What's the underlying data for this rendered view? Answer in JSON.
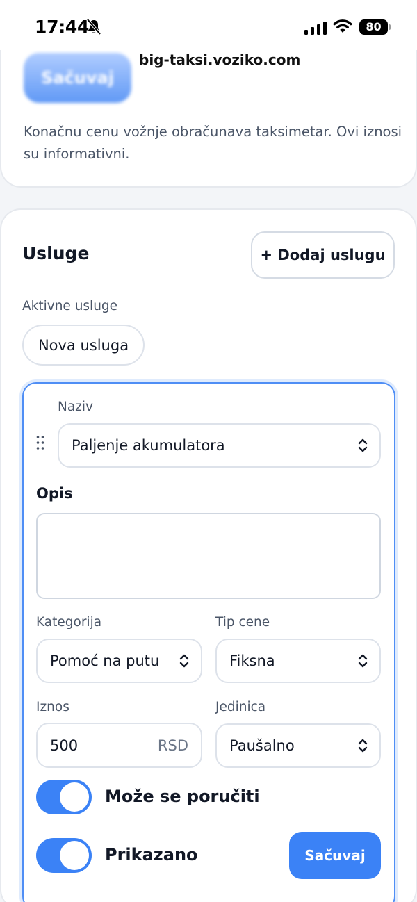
{
  "status_bar": {
    "time": "17:44",
    "battery": "80",
    "icons": [
      "bell-slash-icon",
      "cellular-signal-icon",
      "wifi-icon",
      "battery-icon"
    ]
  },
  "top_card": {
    "ghost_save_label": "Sačuvaj",
    "domain": "big-taksi.voziko.com",
    "info": "Konačnu cenu vožnje obračunava taksimetar. Ovi iznosi su informativni."
  },
  "services": {
    "title": "Usluge",
    "add_button": "+ Dodaj uslugu",
    "active_label": "Aktivne usluge",
    "chips": [
      "Nova usluga"
    ],
    "form": {
      "name_label": "Naziv",
      "name_value": "Paljenje akumulatora",
      "description_label": "Opis",
      "description_value": "",
      "category_label": "Kategorija",
      "category_value": "Pomoć na putu",
      "price_type_label": "Tip cene",
      "price_type_value": "Fiksna",
      "amount_label": "Iznos",
      "amount_value": "500",
      "currency": "RSD",
      "unit_label": "Jedinica",
      "unit_value": "Paušalno",
      "orderable_label": "Može se poručiti",
      "orderable_on": true,
      "shown_label": "Prikazano",
      "shown_on": true,
      "save_label": "Sačuvaj"
    }
  },
  "colors": {
    "accent": "#3b82f6",
    "border": "#dde2ea",
    "muted_text": "#4a5567",
    "page_bg": "#f3f5f8"
  }
}
